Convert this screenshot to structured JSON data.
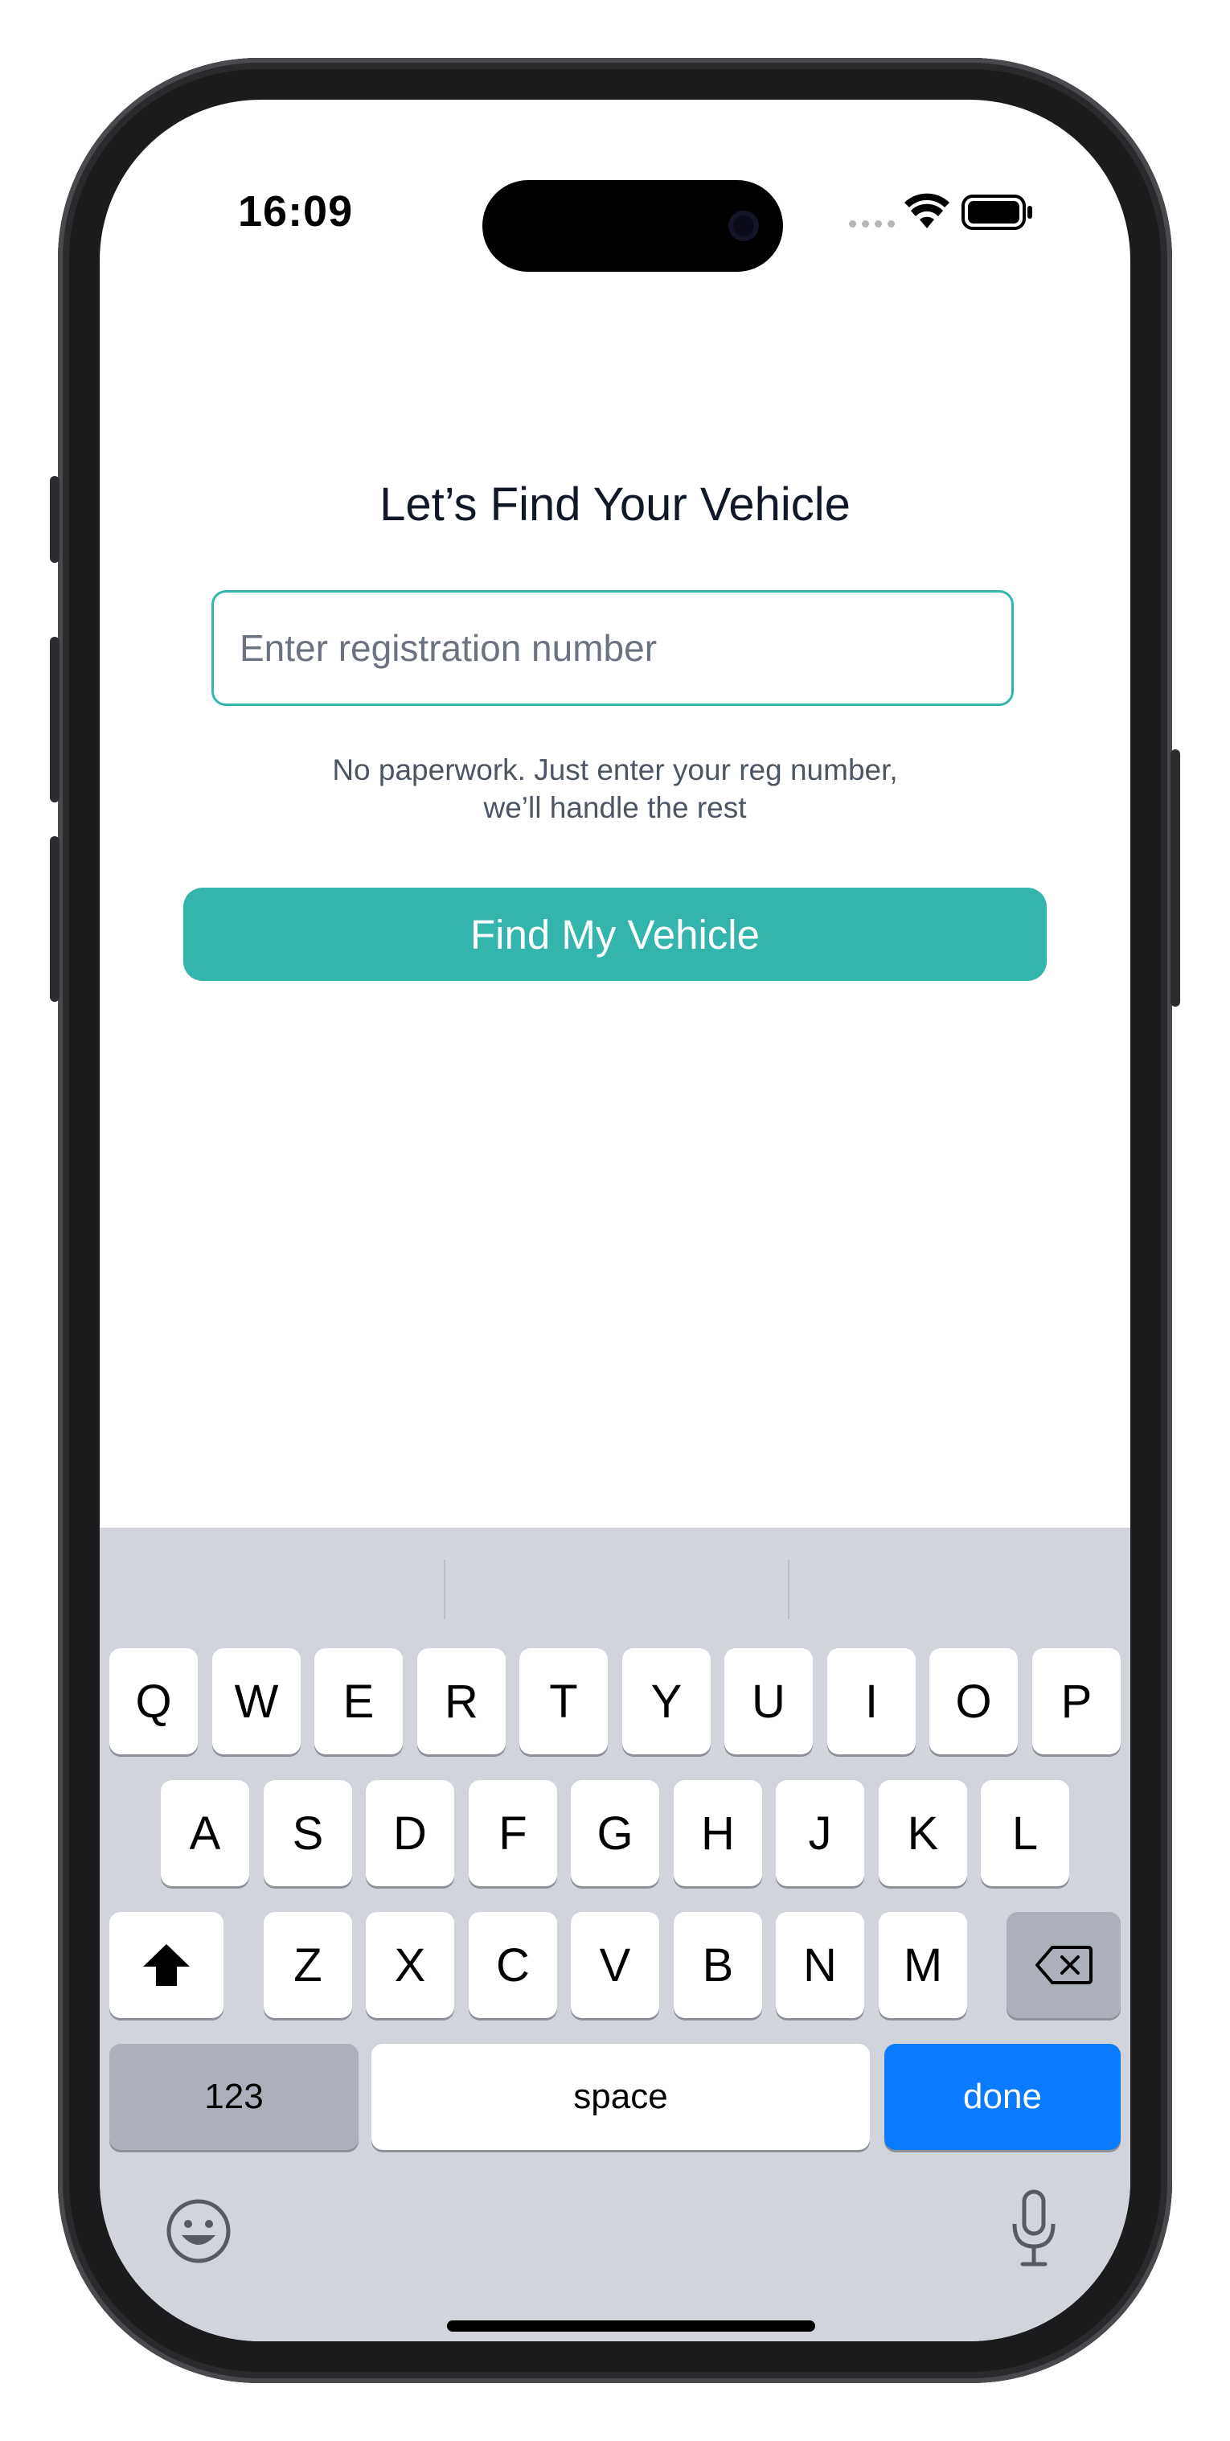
{
  "status_bar": {
    "time": "16:09"
  },
  "main": {
    "title": "Let’s Find Your Vehicle",
    "registration_input": {
      "value": "",
      "placeholder": "Enter registration number"
    },
    "helper_line1": "No paperwork. Just enter your reg number,",
    "helper_line2": "we’ll handle the rest",
    "find_button_label": "Find My Vehicle"
  },
  "keyboard": {
    "row1": [
      "Q",
      "W",
      "E",
      "R",
      "T",
      "Y",
      "U",
      "I",
      "O",
      "P"
    ],
    "row2": [
      "A",
      "S",
      "D",
      "F",
      "G",
      "H",
      "J",
      "K",
      "L"
    ],
    "row3": [
      "Z",
      "X",
      "C",
      "V",
      "B",
      "N",
      "M"
    ],
    "numbers_label": "123",
    "space_label": "space",
    "done_label": "done",
    "icons": {
      "shift": "shift-icon",
      "delete": "delete-icon",
      "emoji": "emoji-icon",
      "dictation": "microphone-icon"
    }
  },
  "colors": {
    "accent": "#33b5ac",
    "done_blue": "#0a7aff",
    "keyboard_bg": "#d1d4db"
  }
}
